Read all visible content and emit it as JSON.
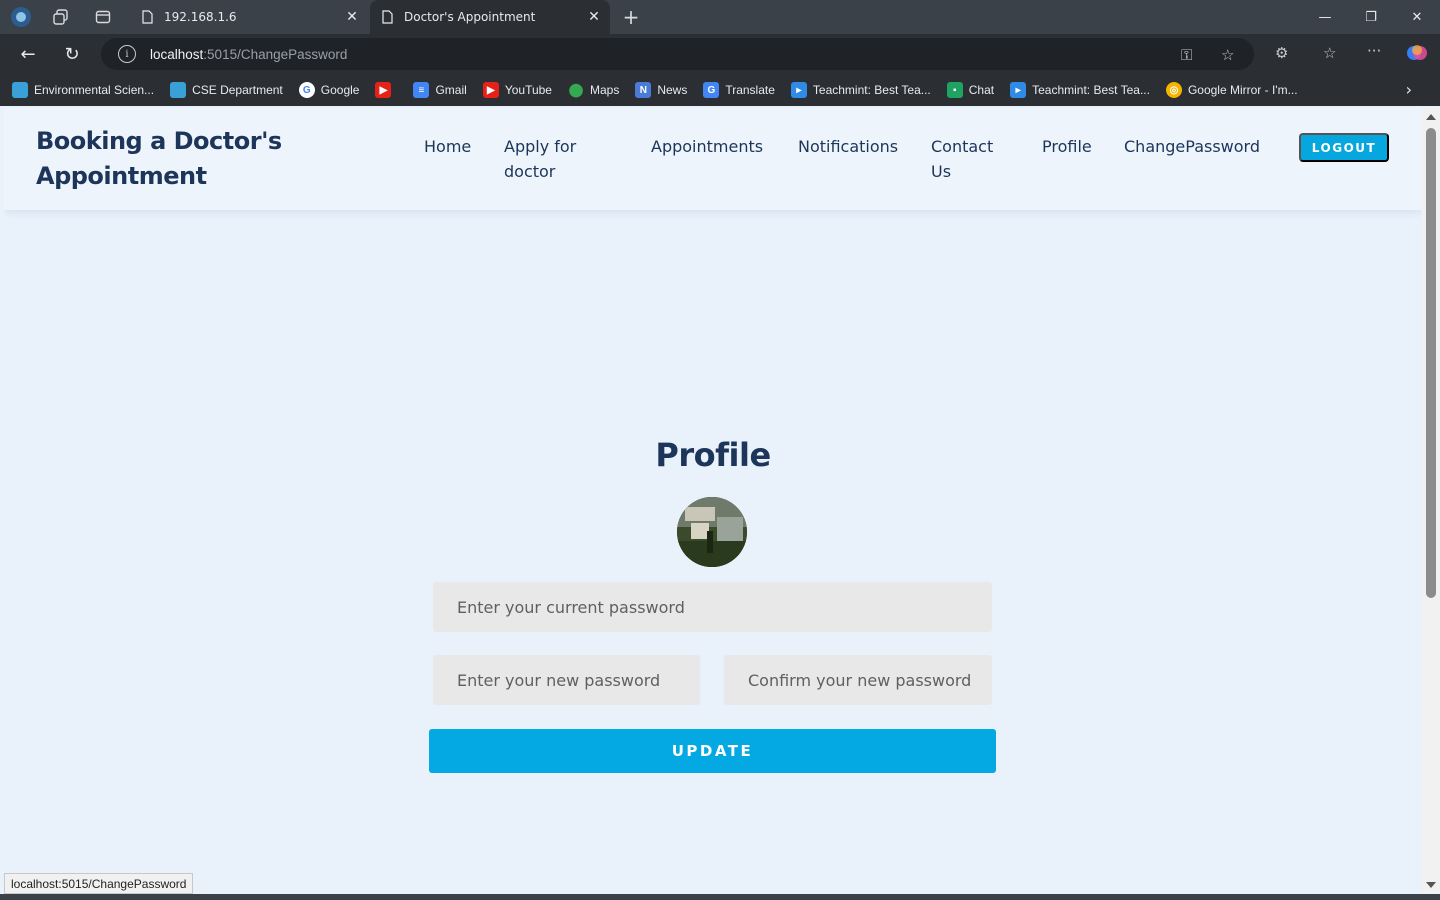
{
  "browser": {
    "tabs": [
      {
        "title": "192.168.1.6",
        "active": false
      },
      {
        "title": "Doctor's Appointment",
        "active": true
      }
    ],
    "url": {
      "host": "localhost",
      "rest": ":5015/ChangePassword"
    },
    "bookmarks": [
      {
        "label": "Environmental Scien...",
        "icon_color": "#3aa0d8"
      },
      {
        "label": "CSE Department",
        "icon_color": "#3aa0d8"
      },
      {
        "label": "Google",
        "icon_color": "#ffffff"
      },
      {
        "label": "",
        "icon_color": "#e62117"
      },
      {
        "label": "Gmail",
        "icon_color": "#4285f4"
      },
      {
        "label": "YouTube",
        "icon_color": "#e62117"
      },
      {
        "label": "Maps",
        "icon_color": "#34a853"
      },
      {
        "label": "News",
        "icon_color": "#4a7bd8"
      },
      {
        "label": "Translate",
        "icon_color": "#4285f4"
      },
      {
        "label": "Teachmint: Best Tea...",
        "icon_color": "#2f8be6"
      },
      {
        "label": "Chat",
        "icon_color": "#1ea362"
      },
      {
        "label": "Teachmint: Best Tea...",
        "icon_color": "#2f8be6"
      },
      {
        "label": "Google Mirror - I'm...",
        "icon_color": "#f4b400"
      }
    ],
    "status_tip": "localhost:5015/ChangePassword"
  },
  "header": {
    "brand": "Booking a Doctor's Appointment",
    "nav": [
      {
        "label": "Home"
      },
      {
        "label": "Apply for doctor"
      },
      {
        "label": "Appointments"
      },
      {
        "label": "Notifications"
      },
      {
        "label": "Contact Us"
      },
      {
        "label": "Profile"
      },
      {
        "label": "ChangePassword"
      }
    ],
    "logout_label": "LOGOUT"
  },
  "main": {
    "title": "Profile",
    "current_password_placeholder": "Enter your current password",
    "new_password_placeholder": "Enter your new password",
    "confirm_password_placeholder": "Confirm your new password",
    "update_label": "UPDATE"
  },
  "colors": {
    "accent": "#04a8e2",
    "heading": "#1c3559",
    "page_bg": "#e9f1fb"
  }
}
